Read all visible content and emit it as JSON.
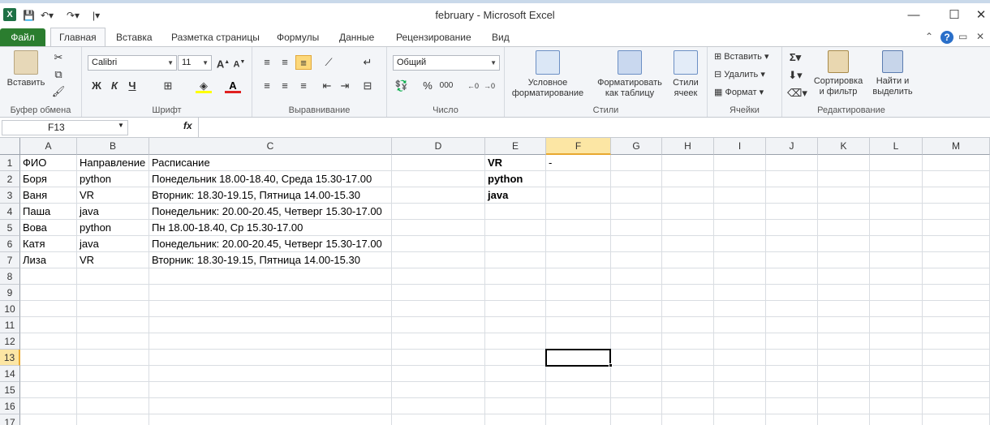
{
  "window": {
    "title": "february  -  Microsoft Excel",
    "minimize": "—",
    "maximize": "☐",
    "close": "✕"
  },
  "tabs": {
    "file": "Файл",
    "items": [
      "Главная",
      "Вставка",
      "Разметка страницы",
      "Формулы",
      "Данные",
      "Рецензирование",
      "Вид"
    ]
  },
  "ribbon": {
    "clipboard": {
      "paste": "Вставить",
      "label": "Буфер обмена"
    },
    "font": {
      "name": "Calibri",
      "size": "11",
      "bold": "Ж",
      "italic": "К",
      "underline": "Ч",
      "label": "Шрифт"
    },
    "alignment": {
      "label": "Выравнивание"
    },
    "number": {
      "format": "Общий",
      "percent": "%",
      "thousands": "000",
      "label": "Число"
    },
    "styles": {
      "conditional": "Условное форматирование",
      "as_table": "Форматировать как таблицу",
      "cell_styles": "Стили ячеек",
      "label": "Стили"
    },
    "cells": {
      "insert": "Вставить",
      "delete": "Удалить",
      "format": "Формат",
      "label": "Ячейки"
    },
    "editing": {
      "sort": "Сортировка и фильтр",
      "find": "Найти и выделить",
      "label": "Редактирование"
    }
  },
  "formula_bar": {
    "name_box": "F13",
    "fx": "fx",
    "value": ""
  },
  "columns": [
    "A",
    "B",
    "C",
    "D",
    "E",
    "F",
    "G",
    "H",
    "I",
    "J",
    "K",
    "L",
    "M"
  ],
  "rows": [
    "1",
    "2",
    "3",
    "4",
    "5",
    "6",
    "7",
    "8",
    "9",
    "10",
    "11",
    "12",
    "13",
    "14",
    "15",
    "16",
    "17"
  ],
  "selected_cell": "F13",
  "cells": {
    "A1": "ФИО",
    "B1": "Направление",
    "C1": "Расписание",
    "E1": "VR",
    "F1": "-",
    "A2": "Боря",
    "B2": "python",
    "C2": "Понедельник 18.00-18.40, Среда 15.30-17.00",
    "E2": "python",
    "A3": "Ваня",
    "B3": "VR",
    "C3": "Вторник: 18.30-19.15, Пятница 14.00-15.30",
    "E3": "java",
    "A4": "Паша",
    "B4": "java",
    "C4": "Понедельник: 20.00-20.45, Четверг 15.30-17.00",
    "A5": "Вова",
    "B5": "python",
    "C5": "Пн 18.00-18.40, Ср 15.30-17.00",
    "A6": "Катя",
    "B6": "java",
    "C6": "Понедельник: 20.00-20.45, Четверг 15.30-17.00",
    "A7": "Лиза",
    "B7": "VR",
    "C7": "Вторник: 18.30-19.15, Пятница 14.00-15.30"
  }
}
